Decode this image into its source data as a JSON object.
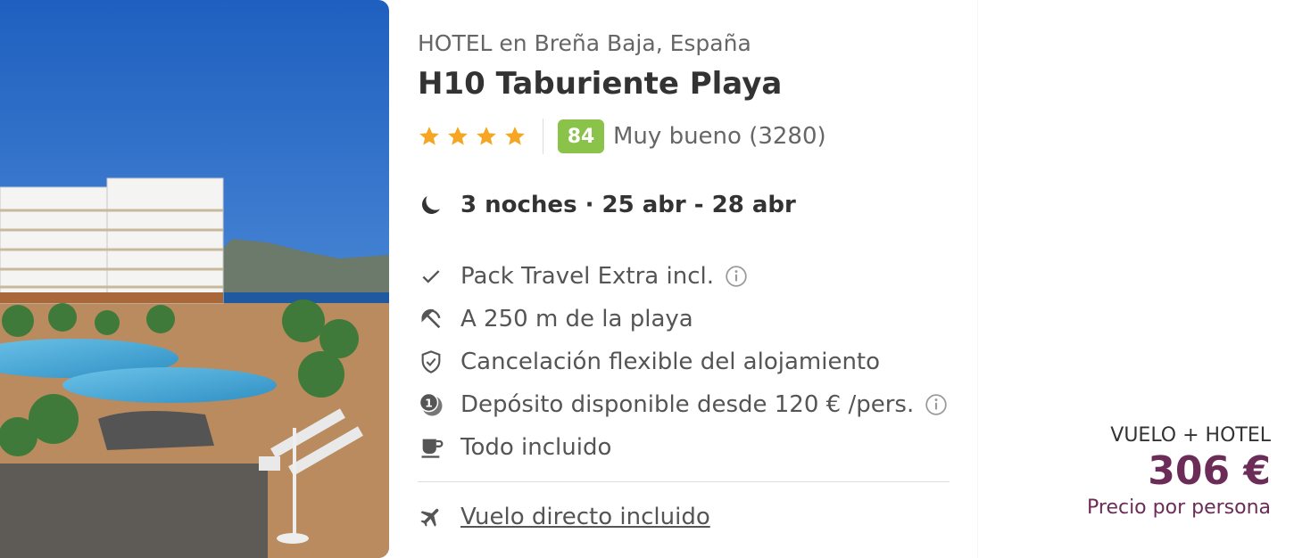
{
  "hotel": {
    "location": "HOTEL en Breña Baja, España",
    "name": "H10 Taburiente Playa",
    "stars": 4,
    "score": "84",
    "rating_text": "Muy bueno (3280)"
  },
  "trip": {
    "summary": "3 noches · 25 abr - 28 abr"
  },
  "features": [
    {
      "icon": "check-icon",
      "label": "Pack Travel Extra incl.",
      "info": true
    },
    {
      "icon": "beach-umbrella-icon",
      "label": "A 250 m de la playa",
      "info": false
    },
    {
      "icon": "shield-check-icon",
      "label": "Cancelación flexible del alojamiento",
      "info": false
    },
    {
      "icon": "deposit-icon",
      "label": "Depósito disponible desde 120 € /pers.",
      "info": true
    },
    {
      "icon": "cup-icon",
      "label": "Todo incluido",
      "info": false
    }
  ],
  "flight": {
    "label": "Vuelo directo incluido"
  },
  "price": {
    "type": "VUELO + HOTEL",
    "amount": "306 €",
    "note": "Precio por persona"
  },
  "colors": {
    "star": "#f5a623",
    "score_badge": "#8bc34a",
    "price": "#6b2c58"
  }
}
